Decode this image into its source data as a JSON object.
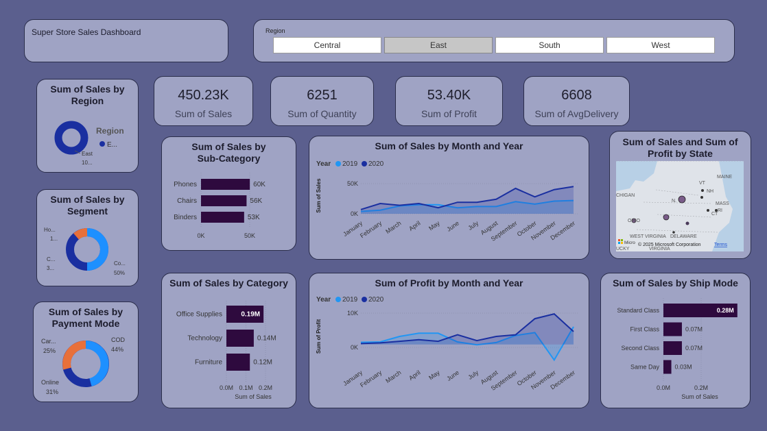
{
  "header": {
    "title": "Super Store Sales Dashboard"
  },
  "slicer": {
    "label": "Region",
    "options": [
      "Central",
      "East",
      "South",
      "West"
    ],
    "selected": "East"
  },
  "kpis": [
    {
      "value": "450.23K",
      "label": "Sum of Sales"
    },
    {
      "value": "6251",
      "label": "Sum of Quantity"
    },
    {
      "value": "53.40K",
      "label": "Sum of Profit"
    },
    {
      "value": "6608",
      "label": "Sum of AvgDelivery"
    }
  ],
  "colors": {
    "background": "#5b5f8e",
    "card": "#9fa3c4",
    "dark_bar": "#2e0a3e",
    "series_2019": "#2196f3",
    "series_2020": "#1a2fa0",
    "donut_blue": "#1e90ff",
    "donut_navy": "#1a2fa0",
    "donut_orange": "#e8703a"
  },
  "region_donut": {
    "title": "Sum of Sales by Region",
    "legend_title": "Region",
    "legend_item": "E...",
    "slice_label": "East",
    "slice_value": "10..."
  },
  "segment_donut": {
    "title": "Sum of Sales by Segment",
    "labels": [
      {
        "name": "Ho...",
        "value": "1..."
      },
      {
        "name": "C...",
        "value": "3..."
      },
      {
        "name": "Co...",
        "value": "50%"
      }
    ]
  },
  "payment_donut": {
    "title": "Sum of Sales by Payment Mode",
    "labels": [
      {
        "name": "Car...",
        "value": "25%"
      },
      {
        "name": "COD",
        "value": "44%"
      },
      {
        "name": "Online",
        "value": "31%"
      }
    ]
  },
  "map": {
    "title": "Sum of Sales and Sum of Profit by State",
    "place_labels": [
      "MAINE",
      "VT",
      "NH",
      "MASS",
      "RI",
      "CT",
      "CHIGAN",
      "OHIO",
      "N.",
      "WEST VIRGINIA",
      "DELAWARE",
      "VIRGINIA",
      "UCKY"
    ],
    "attribution": "© 2025 Microsoft Corporation",
    "terms": "Terms",
    "brand": "Micro"
  },
  "chart_data": [
    {
      "id": "subcategory",
      "type": "bar",
      "title": "Sum of Sales by Sub-Category",
      "categories": [
        "Phones",
        "Chairs",
        "Binders"
      ],
      "values": [
        60000,
        56000,
        53000
      ],
      "value_labels": [
        "60K",
        "56K",
        "53K"
      ],
      "x_ticks": [
        "0K",
        "50K"
      ],
      "xlim": [
        0,
        70000
      ]
    },
    {
      "id": "sales_month",
      "type": "area",
      "title": "Sum of Sales by Month and Year",
      "legend_title": "Year",
      "ylabel": "Sum of Sales",
      "y_ticks": [
        "50K",
        "0K"
      ],
      "ylim": [
        0,
        60000
      ],
      "categories": [
        "January",
        "February",
        "March",
        "April",
        "May",
        "June",
        "July",
        "August",
        "September",
        "October",
        "November",
        "December"
      ],
      "series": [
        {
          "name": "2019",
          "values": [
            4000,
            6000,
            13000,
            15000,
            15000,
            10000,
            12000,
            12000,
            20000,
            16000,
            21000,
            22000
          ]
        },
        {
          "name": "2020",
          "values": [
            7000,
            17000,
            14000,
            17000,
            10000,
            19000,
            19000,
            24000,
            42000,
            28000,
            40000,
            45000
          ]
        }
      ]
    },
    {
      "id": "category",
      "type": "bar",
      "title": "Sum of Sales by Category",
      "categories": [
        "Office Supplies",
        "Technology",
        "Furniture"
      ],
      "values": [
        0.19,
        0.14,
        0.12
      ],
      "value_labels": [
        "0.19M",
        "0.14M",
        "0.12M"
      ],
      "x_ticks": [
        "0.0M",
        "0.1M",
        "0.2M"
      ],
      "xlabel": "Sum of Sales",
      "xlim": [
        0,
        0.2
      ]
    },
    {
      "id": "profit_month",
      "type": "area",
      "title": "Sum of Profit by Month and Year",
      "legend_title": "Year",
      "ylabel": "Sum of Profit",
      "y_ticks": [
        "10K",
        "0K"
      ],
      "ylim": [
        -6000,
        11000
      ],
      "categories": [
        "January",
        "February",
        "March",
        "April",
        "May",
        "June",
        "July",
        "August",
        "September",
        "October",
        "November",
        "December"
      ],
      "series": [
        {
          "name": "2019",
          "values": [
            700,
            800,
            2500,
            3500,
            3500,
            800,
            -100,
            600,
            2800,
            3700,
            -4800,
            5500
          ]
        },
        {
          "name": "2020",
          "values": [
            300,
            500,
            1000,
            1500,
            1000,
            3000,
            1200,
            2500,
            3000,
            8000,
            9500,
            4000
          ]
        }
      ]
    },
    {
      "id": "shipmode",
      "type": "bar",
      "title": "Sum of Sales by Ship Mode",
      "categories": [
        "Standard Class",
        "First Class",
        "Second Class",
        "Same Day"
      ],
      "values": [
        0.28,
        0.07,
        0.07,
        0.03
      ],
      "value_labels": [
        "0.28M",
        "0.07M",
        "0.07M",
        "0.03M"
      ],
      "x_ticks": [
        "0.0M",
        "0.2M"
      ],
      "xlabel": "Sum of Sales",
      "xlim": [
        0,
        0.4
      ]
    }
  ]
}
